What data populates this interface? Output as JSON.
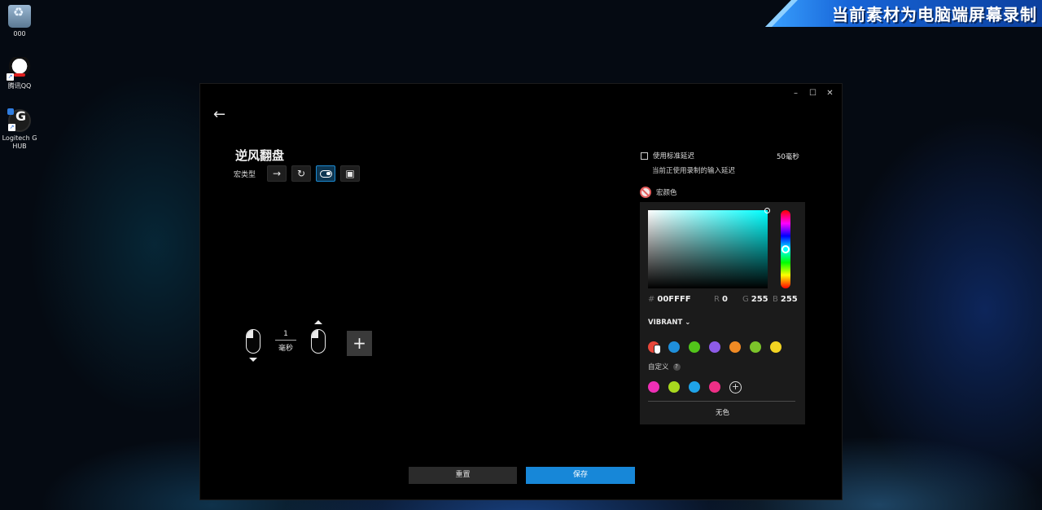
{
  "desktop": {
    "icons": [
      {
        "label": "000"
      },
      {
        "label": "腾讯QQ"
      },
      {
        "label": "Logitech G HUB"
      }
    ]
  },
  "banner": {
    "text": "当前素材为电脑端屏幕录制"
  },
  "window": {
    "controls": {
      "minimize": "–",
      "maximize": "☐",
      "close": "✕"
    },
    "back": "←"
  },
  "macro": {
    "title": "逆风翻盘",
    "type_label": "宏类型",
    "type_buttons": [
      {
        "icon": "arrow-right-icon",
        "glyph": "→"
      },
      {
        "icon": "repeat-icon",
        "glyph": "↻"
      },
      {
        "icon": "toggle-icon",
        "active": true
      },
      {
        "icon": "sequence-icon",
        "glyph": "▣"
      }
    ]
  },
  "timeline": {
    "delay_value": "1",
    "delay_unit": "毫秒",
    "add": "+"
  },
  "settings": {
    "standard_delay_label": "使用标准延迟",
    "standard_delay_value": "50毫秒",
    "standard_delay_checked": false,
    "recorded_delay_note": "当前正使用录制的输入延迟",
    "macro_color_label": "宏颜色"
  },
  "color_picker": {
    "hex_label": "#",
    "hex": "00FFFF",
    "r_label": "R",
    "r": "0",
    "g_label": "G",
    "g": "255",
    "b_label": "B",
    "b": "255",
    "palette": "VIBRANT",
    "swatches": [
      "#e8473a",
      "#1f8fdb",
      "#52c41a",
      "#8e5be8",
      "#f08a24",
      "#7cc42a",
      "#f2d422"
    ],
    "custom_label": "自定义",
    "custom_swatches": [
      "#ee2fb6",
      "#a8d81e",
      "#1fa3e8",
      "#ee2f86"
    ],
    "add_custom": "+",
    "none_label": "无色"
  },
  "footer": {
    "reset_label": "重置",
    "save_label": "保存"
  }
}
